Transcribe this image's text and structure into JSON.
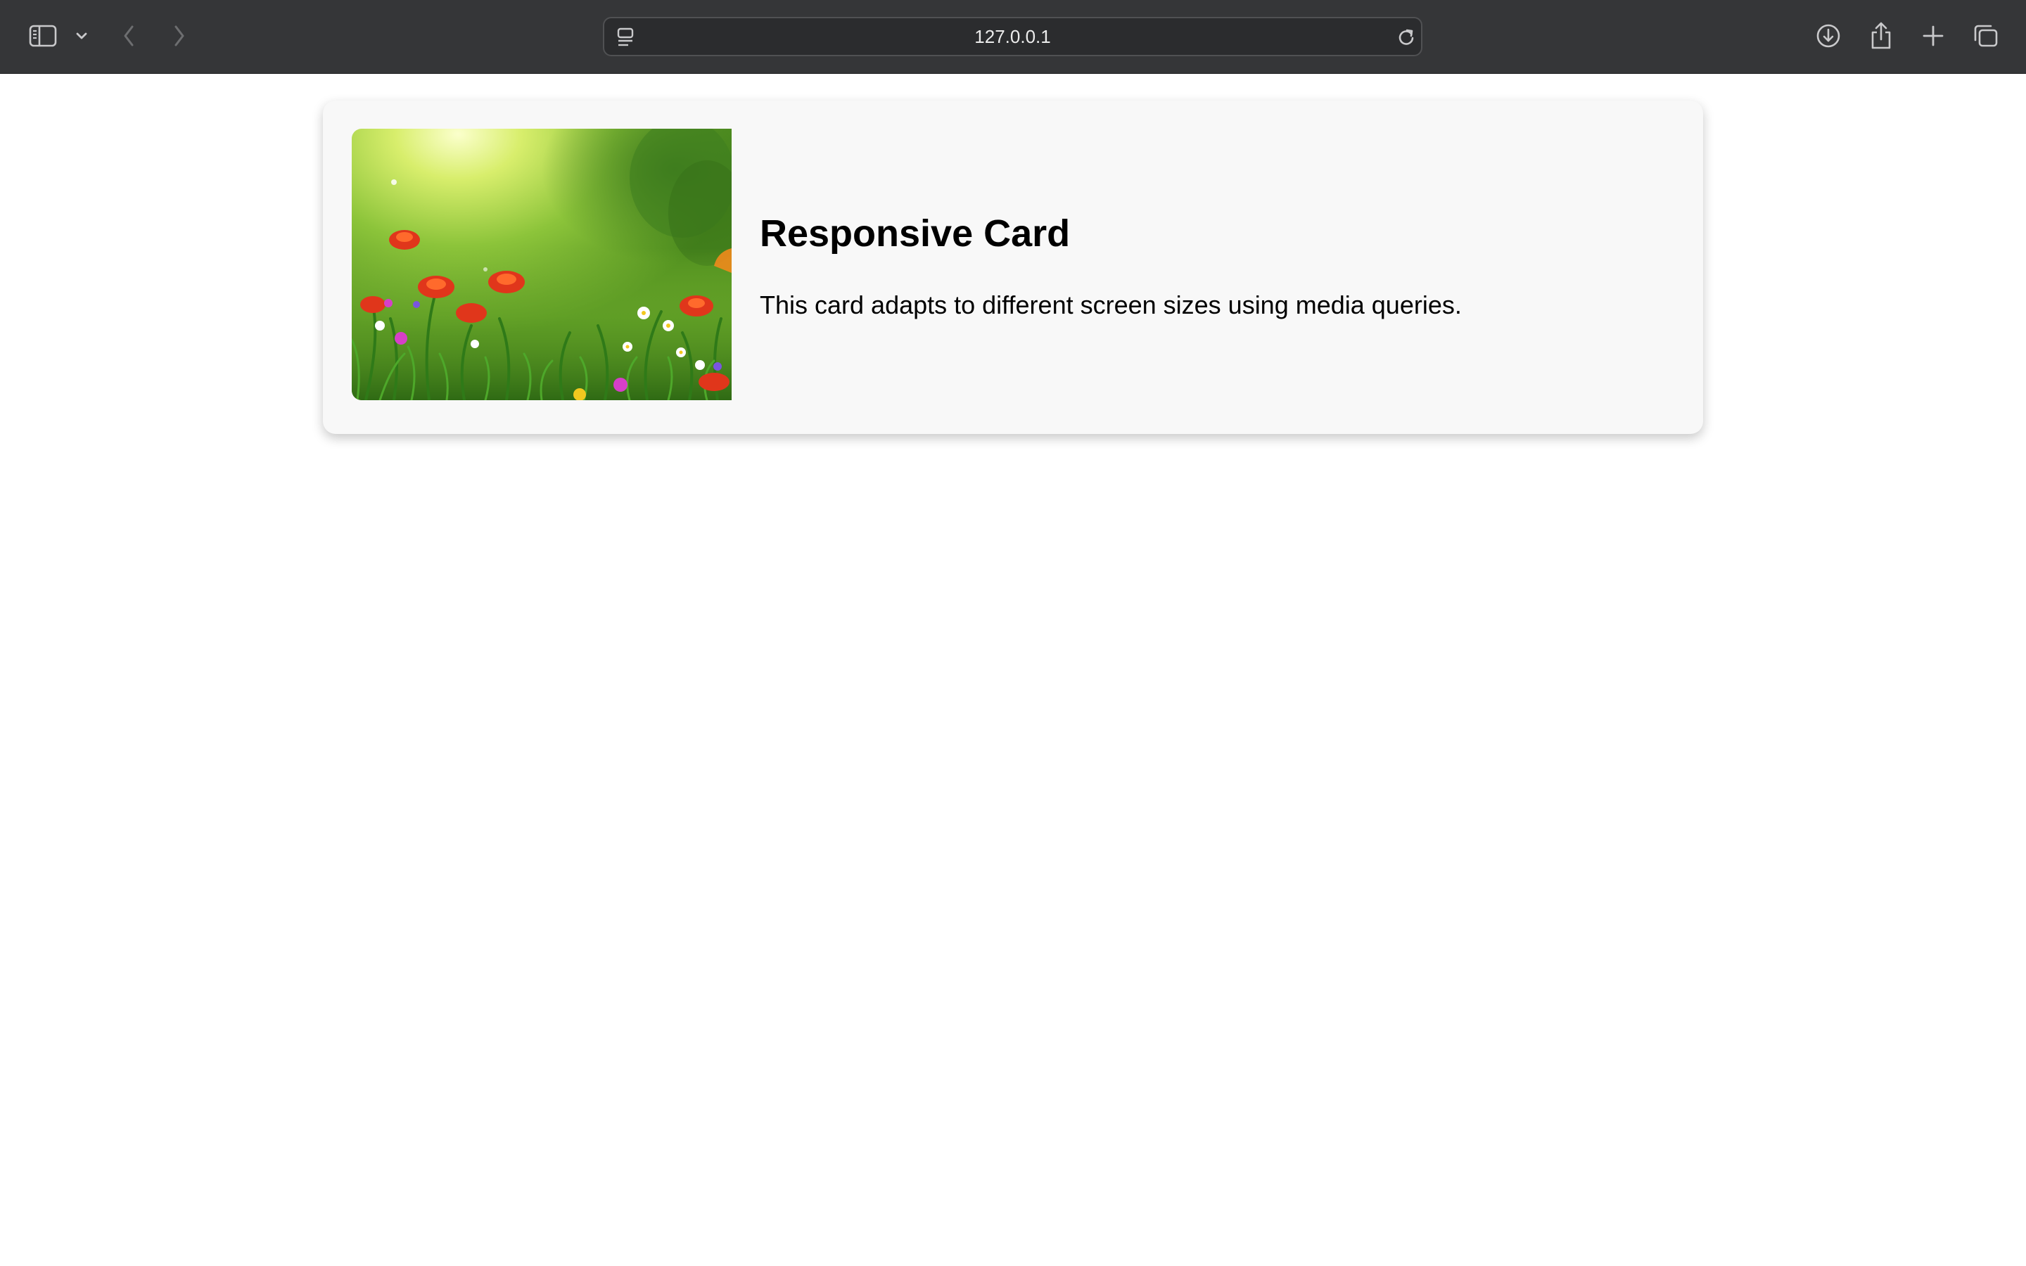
{
  "browser": {
    "url": "127.0.0.1",
    "icons": {
      "sidebar": "sidebar-icon",
      "sidebar_menu": "chevron-down-icon",
      "back": "chevron-left-icon",
      "forward": "chevron-right-icon",
      "page_settings": "page-settings-icon",
      "reload": "reload-icon",
      "downloads": "download-icon",
      "share": "share-icon",
      "new_tab": "plus-icon",
      "tab_overview": "tabs-overview-icon"
    },
    "toolbar_color": "#353638"
  },
  "card": {
    "title": "Responsive Card",
    "text": "This card adapts to different screen sizes using media queries.",
    "image": "flower-meadow-image",
    "background": "#f8f8f8"
  }
}
